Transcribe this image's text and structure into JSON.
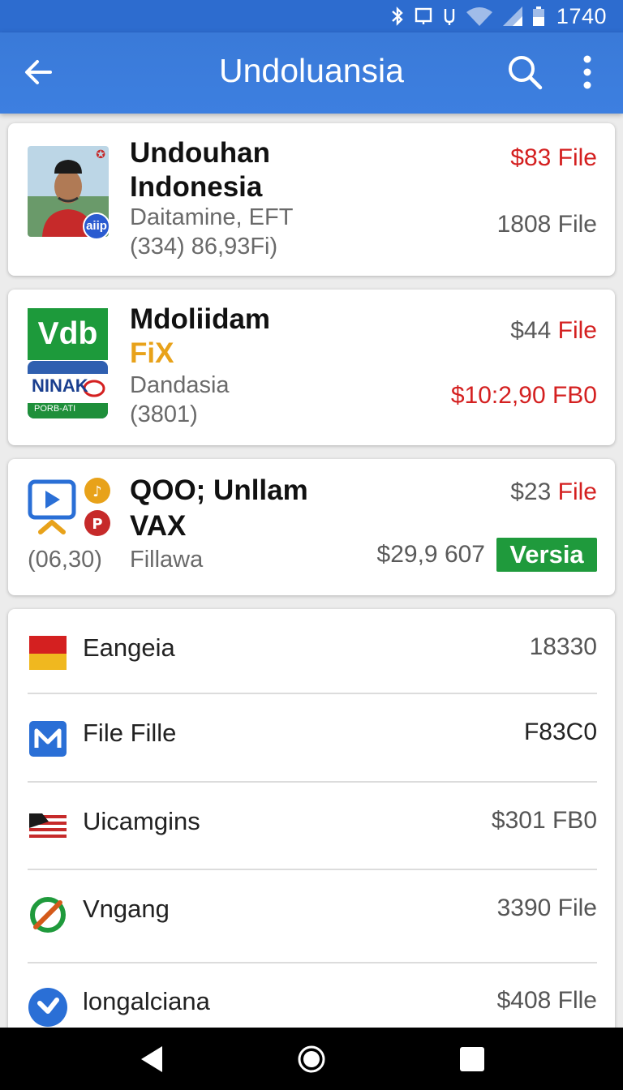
{
  "status_bar": {
    "time": "1740"
  },
  "app_bar": {
    "title": "Undoluansia"
  },
  "cards": [
    {
      "title_line1": "Undouhan",
      "title_line2": "Indonesia",
      "subtitle": "Daitamine, EFT",
      "subtitle2": "(334) 86,93Fi)",
      "badge": "aiip",
      "value1": "$83 File",
      "value2": "1808 File"
    },
    {
      "logo_text": "Vdb",
      "logo2_text": "NINAK",
      "logo2_sub": "PORB-ATI",
      "title_line1": "Mdoliidam",
      "title_line2": "FiX",
      "subtitle": "Dandasia",
      "subtitle2": "(3801)",
      "value1_prefix": "$44",
      "value1_suffix": "File",
      "value2": "$10:2,90 FB0"
    },
    {
      "title_line1": "QOO; Unllam",
      "title_line2": "VAX",
      "subtitle_left": "(06,30)",
      "subtitle": "Fillawa",
      "value1_prefix": "$23",
      "value1_suffix": "File",
      "value2": "$29,9 607",
      "tag": "Versia"
    }
  ],
  "list": [
    {
      "label": "Eangeia",
      "value": "18330",
      "icon": "flag-icon"
    },
    {
      "label": "File Fille",
      "value": "F83C0",
      "icon": "mail-icon"
    },
    {
      "label": "Uicamgins",
      "value": "$301 FB0",
      "icon": "striped-flag-icon"
    },
    {
      "label": "Vngang",
      "value": "3390 File",
      "icon": "blocked-icon"
    },
    {
      "label": "longalciana",
      "value": "$408 Flle",
      "icon": "arrow-circle-icon"
    }
  ],
  "colors": {
    "primary": "#3a7ad8",
    "red": "#d42020",
    "green": "#1f8c2e"
  }
}
